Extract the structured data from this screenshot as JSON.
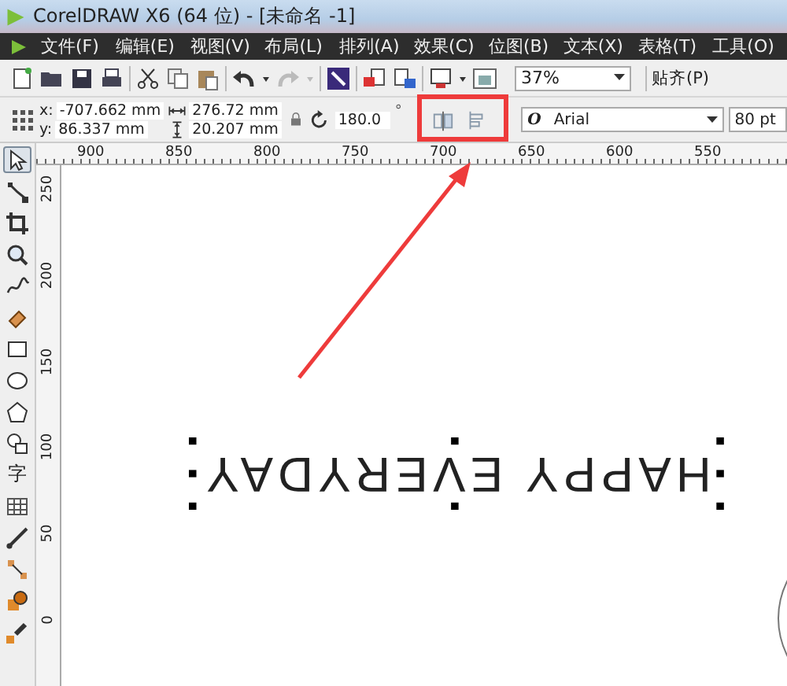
{
  "window": {
    "title": "CorelDRAW X6 (64 位) - [未命名 -1]"
  },
  "menu": [
    "文件(F)",
    "编辑(E)",
    "视图(V)",
    "布局(L)",
    "排列(A)",
    "效果(C)",
    "位图(B)",
    "文本(X)",
    "表格(T)",
    "工具(O)"
  ],
  "toolbar": {
    "zoom": "37%",
    "snap": "贴齐(P)"
  },
  "property_bar": {
    "x_label": "x:",
    "x": "-707.662 mm",
    "y_label": "y:",
    "y": "86.337 mm",
    "width": "276.72 mm",
    "height": "20.207 mm",
    "rotation": "180.0",
    "degree": "°",
    "font_style": "O",
    "font": "Arial",
    "size": "80 pt"
  },
  "horizontal_ruler": [
    "900",
    "850",
    "800",
    "750",
    "700",
    "650",
    "600",
    "550"
  ],
  "vertical_ruler": [
    "250",
    "200",
    "150",
    "100",
    "50",
    "0"
  ],
  "toolbox": [
    {
      "kind": "pointer",
      "selected": true
    },
    {
      "kind": "shape",
      "selected": false
    },
    {
      "kind": "crop",
      "selected": false
    },
    {
      "kind": "zoom",
      "selected": false
    },
    {
      "kind": "freehand",
      "selected": false
    },
    {
      "kind": "smart",
      "selected": false
    },
    {
      "kind": "rectangle",
      "selected": false
    },
    {
      "kind": "ellipse",
      "selected": false
    },
    {
      "kind": "polygon",
      "selected": false
    },
    {
      "kind": "shapes",
      "selected": false
    },
    {
      "kind": "text",
      "glyph": "字",
      "selected": false
    },
    {
      "kind": "table",
      "selected": false
    },
    {
      "kind": "dimension",
      "selected": false
    },
    {
      "kind": "connector",
      "selected": false
    },
    {
      "kind": "effects",
      "selected": false
    },
    {
      "kind": "eyedropper",
      "selected": false
    }
  ],
  "canvas": {
    "text": "HAPPY EVERYDAY",
    "upside_down": true,
    "selected": true
  }
}
